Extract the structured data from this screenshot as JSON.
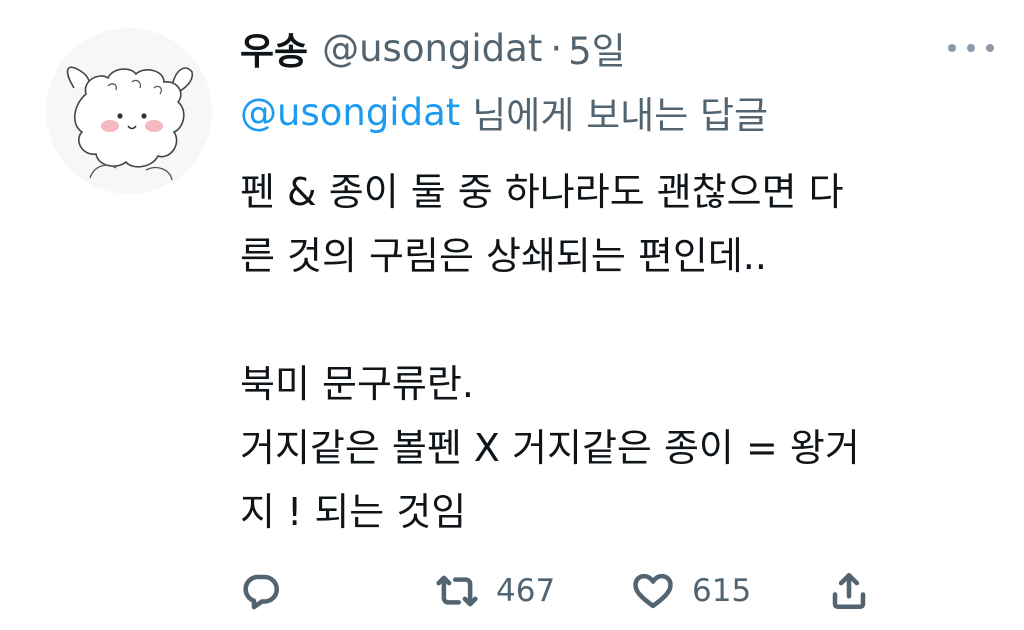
{
  "author": {
    "display_name": "우송",
    "handle": "@usongidat",
    "separator": "·",
    "time": "5일"
  },
  "reply": {
    "handle": "@usongidat",
    "suffix": "님에게 보내는 답글"
  },
  "tweet": {
    "lines": [
      "펜 & 종이 둘 중 하나라도 괜찮으면 다",
      "른 것의 구림은 상쇄되는 편인데..",
      "",
      "북미 문구류란.",
      "거지같은 볼펜 X 거지같은 종이 = 왕거",
      "지 ! 되는 것임"
    ]
  },
  "actions": {
    "retweets": "467",
    "likes": "615"
  },
  "icons": {
    "avatar": "alpaca-avatar",
    "more": "more-icon",
    "reply": "reply-icon",
    "retweet": "retweet-icon",
    "like": "heart-icon",
    "share": "share-icon"
  },
  "colors": {
    "accent": "#1d9bf0",
    "secondary_text": "#536471",
    "primary_text": "#0f1419"
  }
}
